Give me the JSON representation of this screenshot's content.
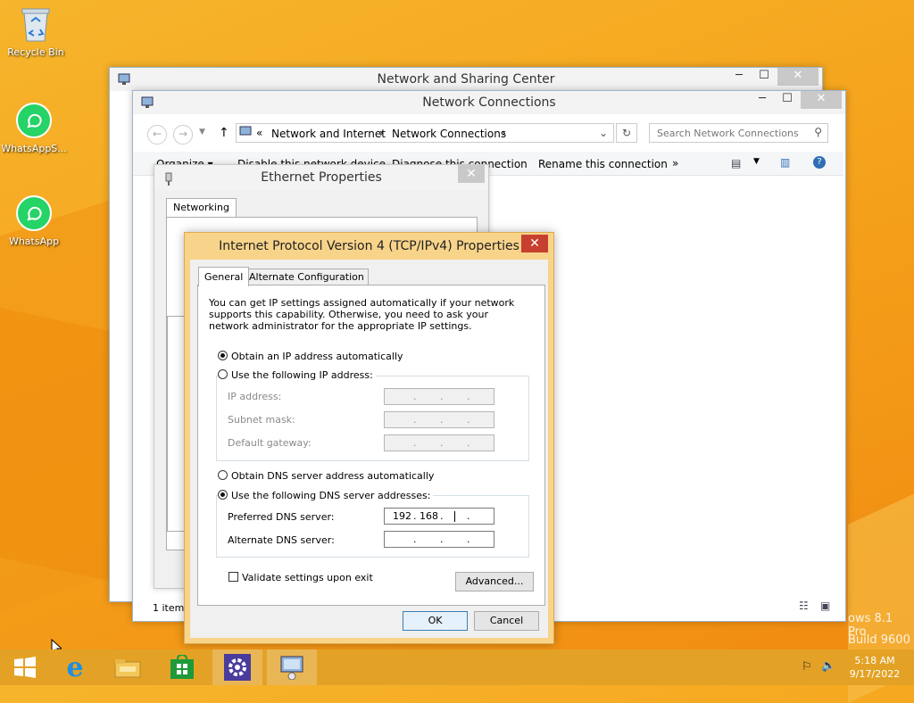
{
  "desktop": {
    "icons": [
      {
        "label": "Recycle Bin"
      },
      {
        "label": "WhatsAppS..."
      },
      {
        "label": "WhatsApp"
      }
    ],
    "watermark_line1": "ows 8.1 Pro",
    "watermark_line2": "Build 9600"
  },
  "nsc_window": {
    "title": "Network and Sharing Center"
  },
  "nc_window": {
    "title": "Network Connections",
    "address_prefix": "«",
    "breadcrumb": [
      "Network and Internet",
      "Network Connections"
    ],
    "search_placeholder": "Search Network Connections",
    "toolbar": {
      "organize": "Organize",
      "disable": "Disable this network device",
      "diagnose": "Diagnose this connection",
      "rename": "Rename this connection",
      "more": "»"
    },
    "status": "1 item"
  },
  "ethernet_window": {
    "title": "Ethernet Properties",
    "tab": "Networking"
  },
  "ipv4_dialog": {
    "title": "Internet Protocol Version 4 (TCP/IPv4) Properties",
    "tabs": [
      "General",
      "Alternate Configuration"
    ],
    "description": "You can get IP settings assigned automatically if your network supports this capability. Otherwise, you need to ask your network administrator for the appropriate IP settings.",
    "radio_obtain_ip": "Obtain an IP address automatically",
    "radio_use_ip": "Use the following IP address:",
    "ip_address_label": "IP address:",
    "subnet_mask_label": "Subnet mask:",
    "default_gateway_label": "Default gateway:",
    "radio_obtain_dns": "Obtain DNS server address automatically",
    "radio_use_dns": "Use the following DNS server addresses:",
    "preferred_dns_label": "Preferred DNS server:",
    "preferred_dns_octet1": "192",
    "preferred_dns_octet2": "168",
    "alternate_dns_label": "Alternate DNS server:",
    "validate_label": "Validate settings upon exit",
    "advanced_button": "Advanced...",
    "ok_button": "OK",
    "cancel_button": "Cancel",
    "dot": "."
  },
  "taskbar": {
    "time": "5:18 AM",
    "date": "9/17/2022"
  },
  "colors": {
    "desktop_bg": "#f5a31c",
    "taskbar": "#e3a226",
    "close_red": "#c7402f",
    "dialog_frame": "#f8d48a"
  }
}
